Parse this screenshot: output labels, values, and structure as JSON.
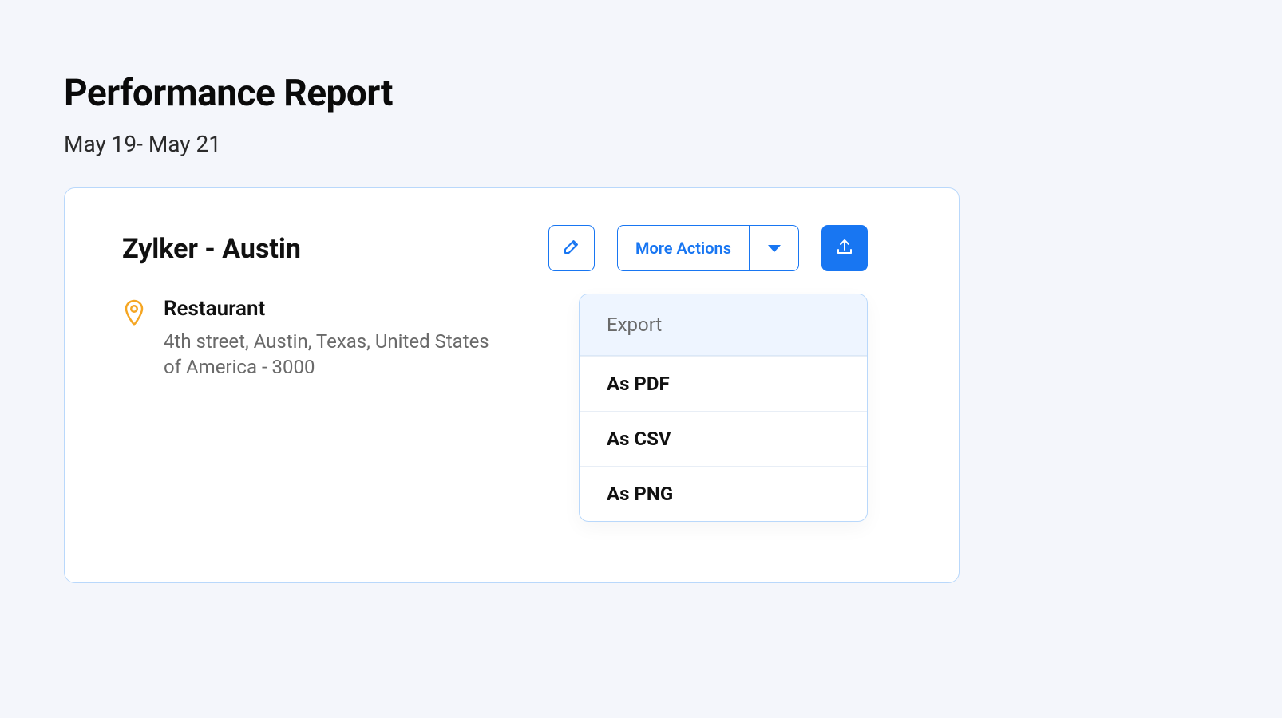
{
  "header": {
    "title": "Performance Report",
    "date_range": "May 19- May 21"
  },
  "entity": {
    "name": "Zylker - Austin",
    "type": "Restaurant",
    "address": "4th street, Austin, Texas, United States of America - 3000"
  },
  "actions": {
    "more_actions_label": "More Actions"
  },
  "export_menu": {
    "header": "Export",
    "options": [
      "As PDF",
      "As CSV",
      "As PNG"
    ]
  },
  "colors": {
    "accent": "#1876f2",
    "border_light": "#b9d8fb",
    "bg": "#f4f6fb",
    "pin": "#f5a623"
  }
}
